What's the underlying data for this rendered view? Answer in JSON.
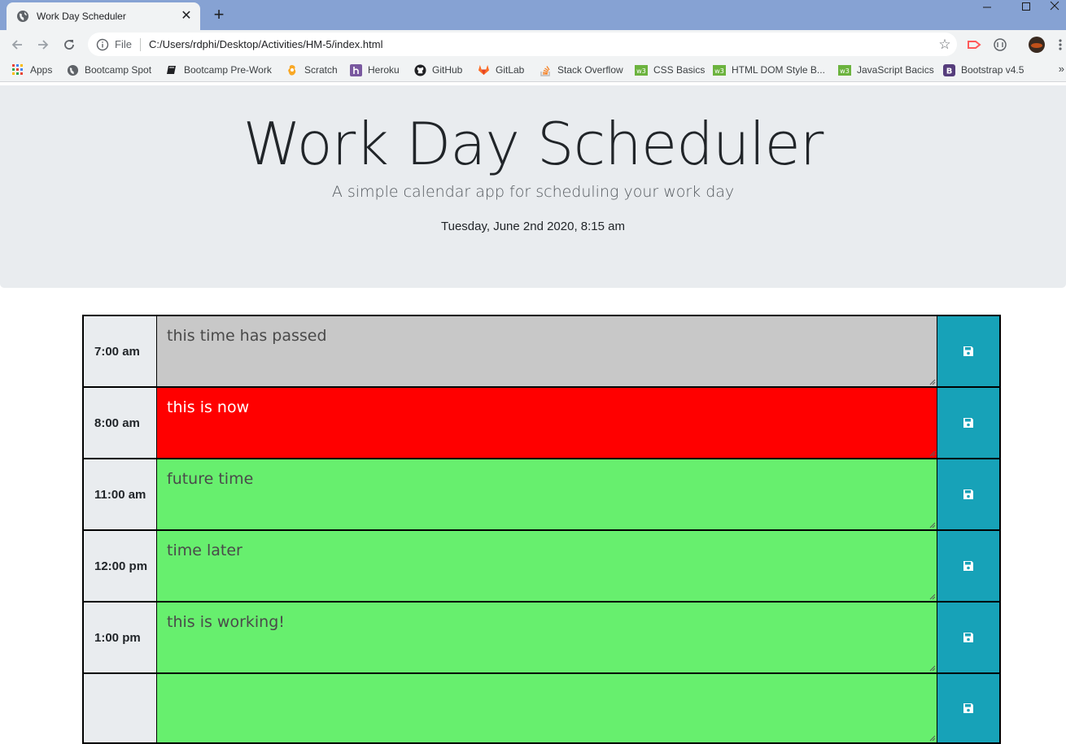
{
  "browser": {
    "tab_title": "Work Day Scheduler",
    "tab_close": "✕",
    "new_tab": "+",
    "file_label": "File",
    "url": "C:/Users/rdphi/Desktop/Activities/HM-5/index.html",
    "bookmarks": [
      {
        "label": "Apps",
        "icon": "apps-grid-icon"
      },
      {
        "label": "Bootcamp Spot",
        "icon": "globe-icon"
      },
      {
        "label": "Bootcamp Pre-Work",
        "icon": "book-icon"
      },
      {
        "label": "Scratch",
        "icon": "scratch-icon"
      },
      {
        "label": "Heroku",
        "icon": "heroku-icon"
      },
      {
        "label": "GitHub",
        "icon": "github-icon"
      },
      {
        "label": "GitLab",
        "icon": "gitlab-icon"
      },
      {
        "label": "Stack Overflow",
        "icon": "stackoverflow-icon"
      },
      {
        "label": "CSS Basics",
        "icon": "w3schools-icon"
      },
      {
        "label": "HTML DOM Style B...",
        "icon": "w3schools-icon"
      },
      {
        "label": "JavaScript Bacics",
        "icon": "w3schools-icon"
      },
      {
        "label": "Bootstrap v4.5",
        "icon": "bootstrap-icon"
      }
    ],
    "more": "»",
    "colors": {
      "titlebar": "#86a2d3",
      "toolbar": "#f1f3f4"
    }
  },
  "header": {
    "title": "Work Day Scheduler",
    "lead": "A simple calendar app for scheduling your work day",
    "current_day": "Tuesday, June 2nd 2020, 8:15 am"
  },
  "schedule": [
    {
      "hour": "7:00 am",
      "text": "this time has passed",
      "state": "past"
    },
    {
      "hour": "8:00 am",
      "text": "this is now",
      "state": "present"
    },
    {
      "hour": "11:00 am",
      "text": "future time",
      "state": "future"
    },
    {
      "hour": "12:00 pm",
      "text": "time later",
      "state": "future"
    },
    {
      "hour": "1:00 pm",
      "text": "this is working!",
      "state": "future"
    },
    {
      "hour": "",
      "text": "",
      "state": "future"
    }
  ],
  "colors": {
    "past": "#c8c8c8",
    "present": "#ff0000",
    "future": "#67ef6e",
    "save": "#17a2b8"
  },
  "icons": {
    "save": "floppy-disk-icon"
  }
}
